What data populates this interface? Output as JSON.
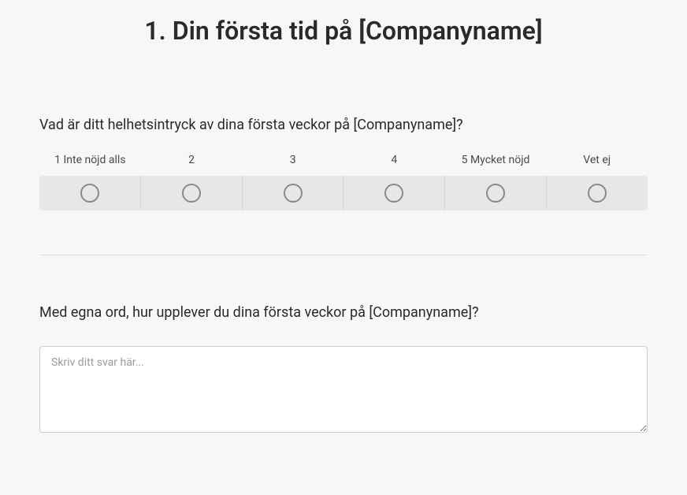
{
  "title": "1. Din första tid på [Companyname]",
  "question1": {
    "text": "Vad är ditt helhetsintryck av dina första veckor på [Companyname]?",
    "options": [
      "1 Inte nöjd alls",
      "2",
      "3",
      "4",
      "5 Mycket nöjd",
      "Vet ej"
    ]
  },
  "question2": {
    "text": "Med egna ord, hur upplever du dina första veckor på [Companyname]?",
    "placeholder": "Skriv ditt svar här..."
  }
}
